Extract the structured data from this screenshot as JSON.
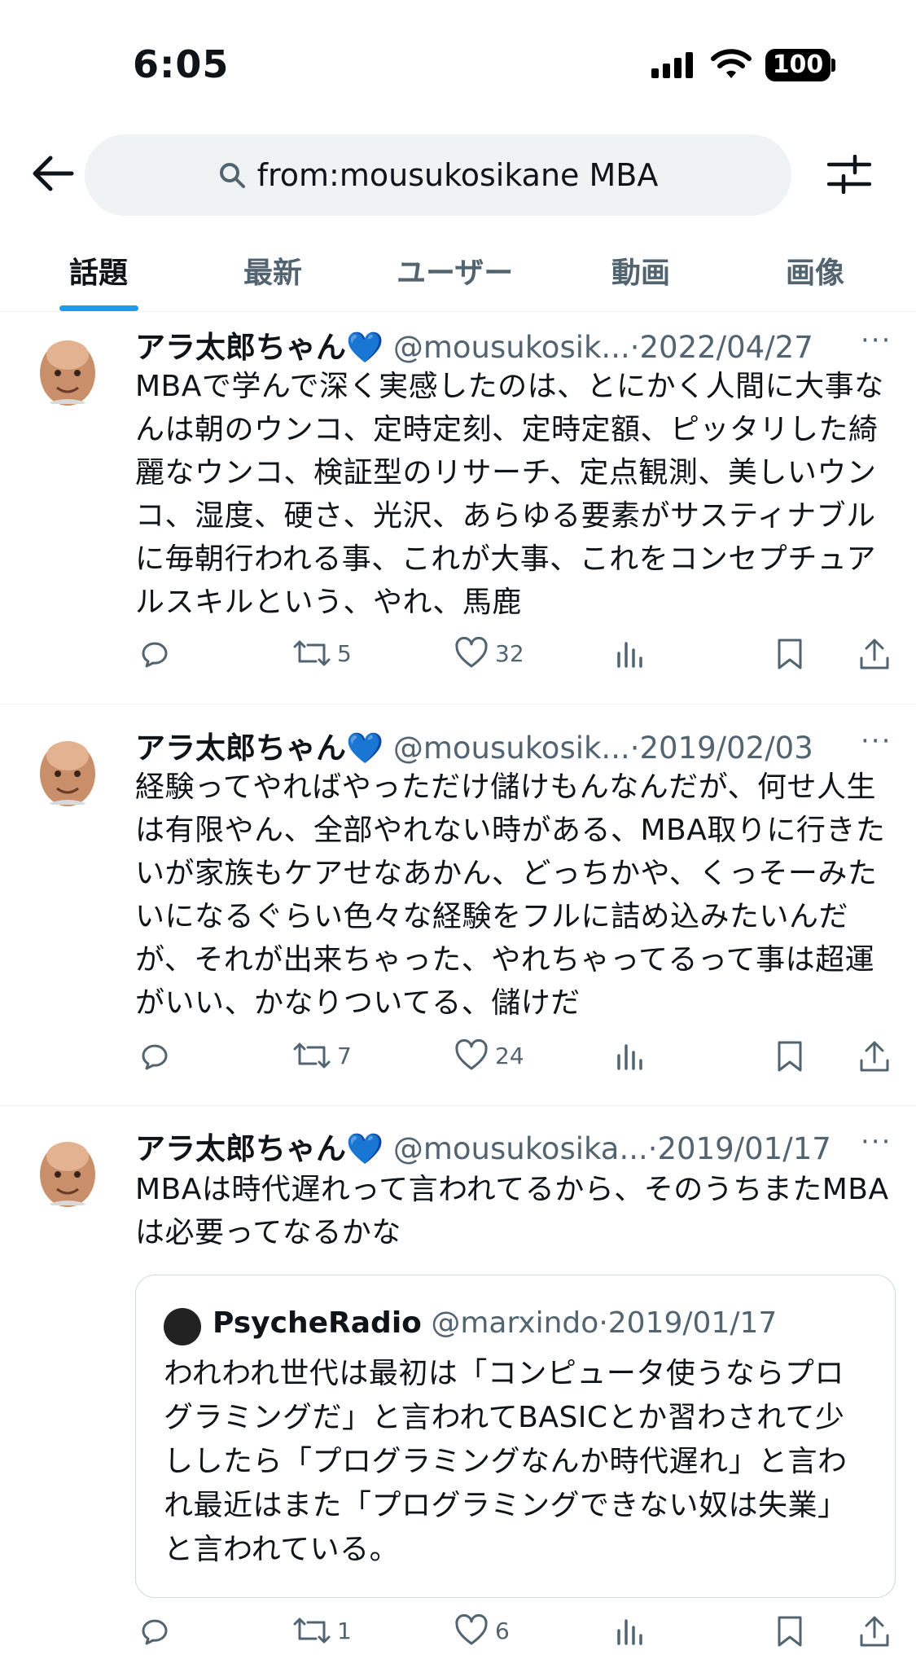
{
  "status_bar": {
    "time": "6:05",
    "battery": "100"
  },
  "search": {
    "query": "from:mousukosikane MBA"
  },
  "tabs": [
    {
      "label": "話題"
    },
    {
      "label": "最新"
    },
    {
      "label": "ユーザー"
    },
    {
      "label": "動画"
    },
    {
      "label": "画像"
    }
  ],
  "tweets": [
    {
      "name": "アラ太郎ちゃん💙",
      "handle": "@mousukosik...",
      "date": "2022/04/27",
      "text": "MBAで学んで深く実感したのは、とにかく人間に大事なんは朝のウンコ、定時定刻、定時定額、ピッタリした綺麗なウンコ、検証型のリサーチ、定点観測、美しいウンコ、湿度、硬さ、光沢、あらゆる要素がサスティナブルに毎朝行われる事、これが大事、これをコンセプチュアルスキルという、やれ、馬鹿",
      "retweets": "5",
      "likes": "32"
    },
    {
      "name": "アラ太郎ちゃん💙",
      "handle": "@mousukosik...",
      "date": "2019/02/03",
      "text": "経験ってやればやっただけ儲けもんなんだが、何せ人生は有限やん、全部やれない時がある、MBA取りに行きたいが家族もケアせなあかん、どっちかや、くっそーみたいになるぐらい色々な経験をフルに詰め込みたいんだが、それが出来ちゃった、やれちゃってるって事は超運がいい、かなりついてる、儲けだ",
      "retweets": "7",
      "likes": "24"
    },
    {
      "name": "アラ太郎ちゃん💙",
      "handle": "@mousukosika...",
      "date": "2019/01/17",
      "text": "MBAは時代遅れって言われてるから、そのうちまたMBAは必要ってなるかな",
      "retweets": "1",
      "likes": "6",
      "quote": {
        "name": "PsycheRadio",
        "handle": "@marxindo",
        "date": "2019/01/17",
        "text": "われわれ世代は最初は「コンピュータ使うならプログラミングだ」と言われてBASICとか習わされて少ししたら「プログラミングなんか時代遅れ」と言われ最近はまた「プログラミングできない奴は失業」と言われている。"
      }
    }
  ],
  "colors": {
    "accent": "#1d9bf0",
    "text": "#0f1419",
    "secondary": "#536471",
    "heart": "#1d9bf0"
  }
}
